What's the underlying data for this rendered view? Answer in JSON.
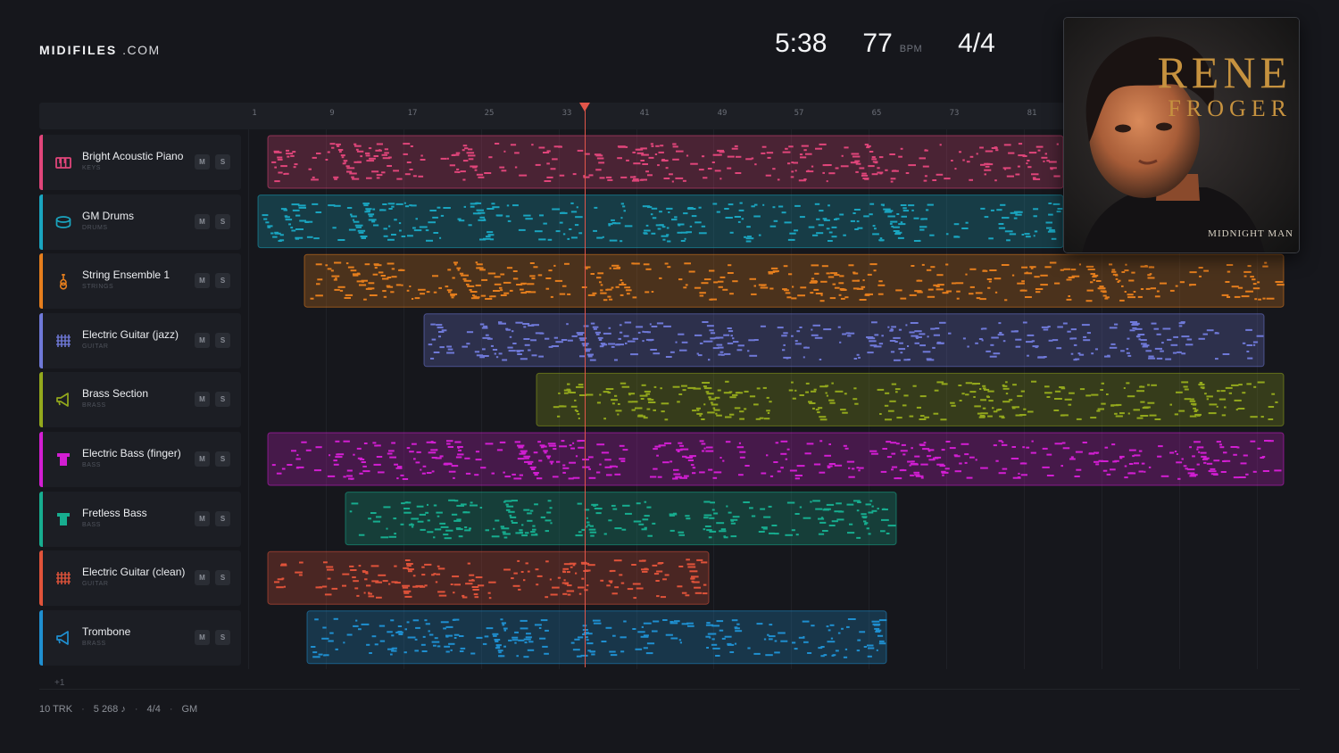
{
  "brand": {
    "name": "MIDIFILES",
    "suffix": ".COM"
  },
  "transport": {
    "time": "5:38",
    "bpm": "77",
    "bpm_unit": "BPM",
    "time_signature": "4/4"
  },
  "ruler": {
    "labels": [
      "1",
      "9",
      "17",
      "25",
      "33",
      "41",
      "49",
      "57",
      "65",
      "73",
      "81"
    ]
  },
  "tracks": [
    {
      "name": "Bright Acoustic Piano",
      "category": "KEYS",
      "color": "#e0457a",
      "icon": "piano-icon",
      "mute": "M",
      "solo": "S"
    },
    {
      "name": "GM Drums",
      "category": "DRUMS",
      "color": "#1aa5c0",
      "icon": "drum-icon",
      "mute": "M",
      "solo": "S"
    },
    {
      "name": "String Ensemble 1",
      "category": "STRINGS",
      "color": "#e57e1d",
      "icon": "violin-icon",
      "mute": "M",
      "solo": "S"
    },
    {
      "name": "Electric Guitar (jazz)",
      "category": "GUITAR",
      "color": "#6f79d8",
      "icon": "guitar-fretboard-icon",
      "mute": "M",
      "solo": "S"
    },
    {
      "name": "Brass Section",
      "category": "BRASS",
      "color": "#93a81c",
      "icon": "horn-icon",
      "mute": "M",
      "solo": "S"
    },
    {
      "name": "Electric Bass (finger)",
      "category": "BASS",
      "color": "#d21ed2",
      "icon": "bass-icon",
      "mute": "M",
      "solo": "S"
    },
    {
      "name": "Fretless Bass",
      "category": "BASS",
      "color": "#17ad8f",
      "icon": "bass-icon",
      "mute": "M",
      "solo": "S"
    },
    {
      "name": "Electric Guitar (clean)",
      "category": "GUITAR",
      "color": "#e0533a",
      "icon": "guitar-fretboard-icon",
      "mute": "M",
      "solo": "S"
    },
    {
      "name": "Trombone",
      "category": "BRASS",
      "color": "#1f8fd0",
      "icon": "horn-icon",
      "mute": "M",
      "solo": "S"
    }
  ],
  "more_tracks": "+1",
  "footer": {
    "tracks": "10 TRK",
    "notes": "5 268 ♪",
    "signature": "4/4",
    "standard": "GM"
  },
  "album": {
    "artist": "RENE FROGER",
    "title": "Midnight Man"
  }
}
